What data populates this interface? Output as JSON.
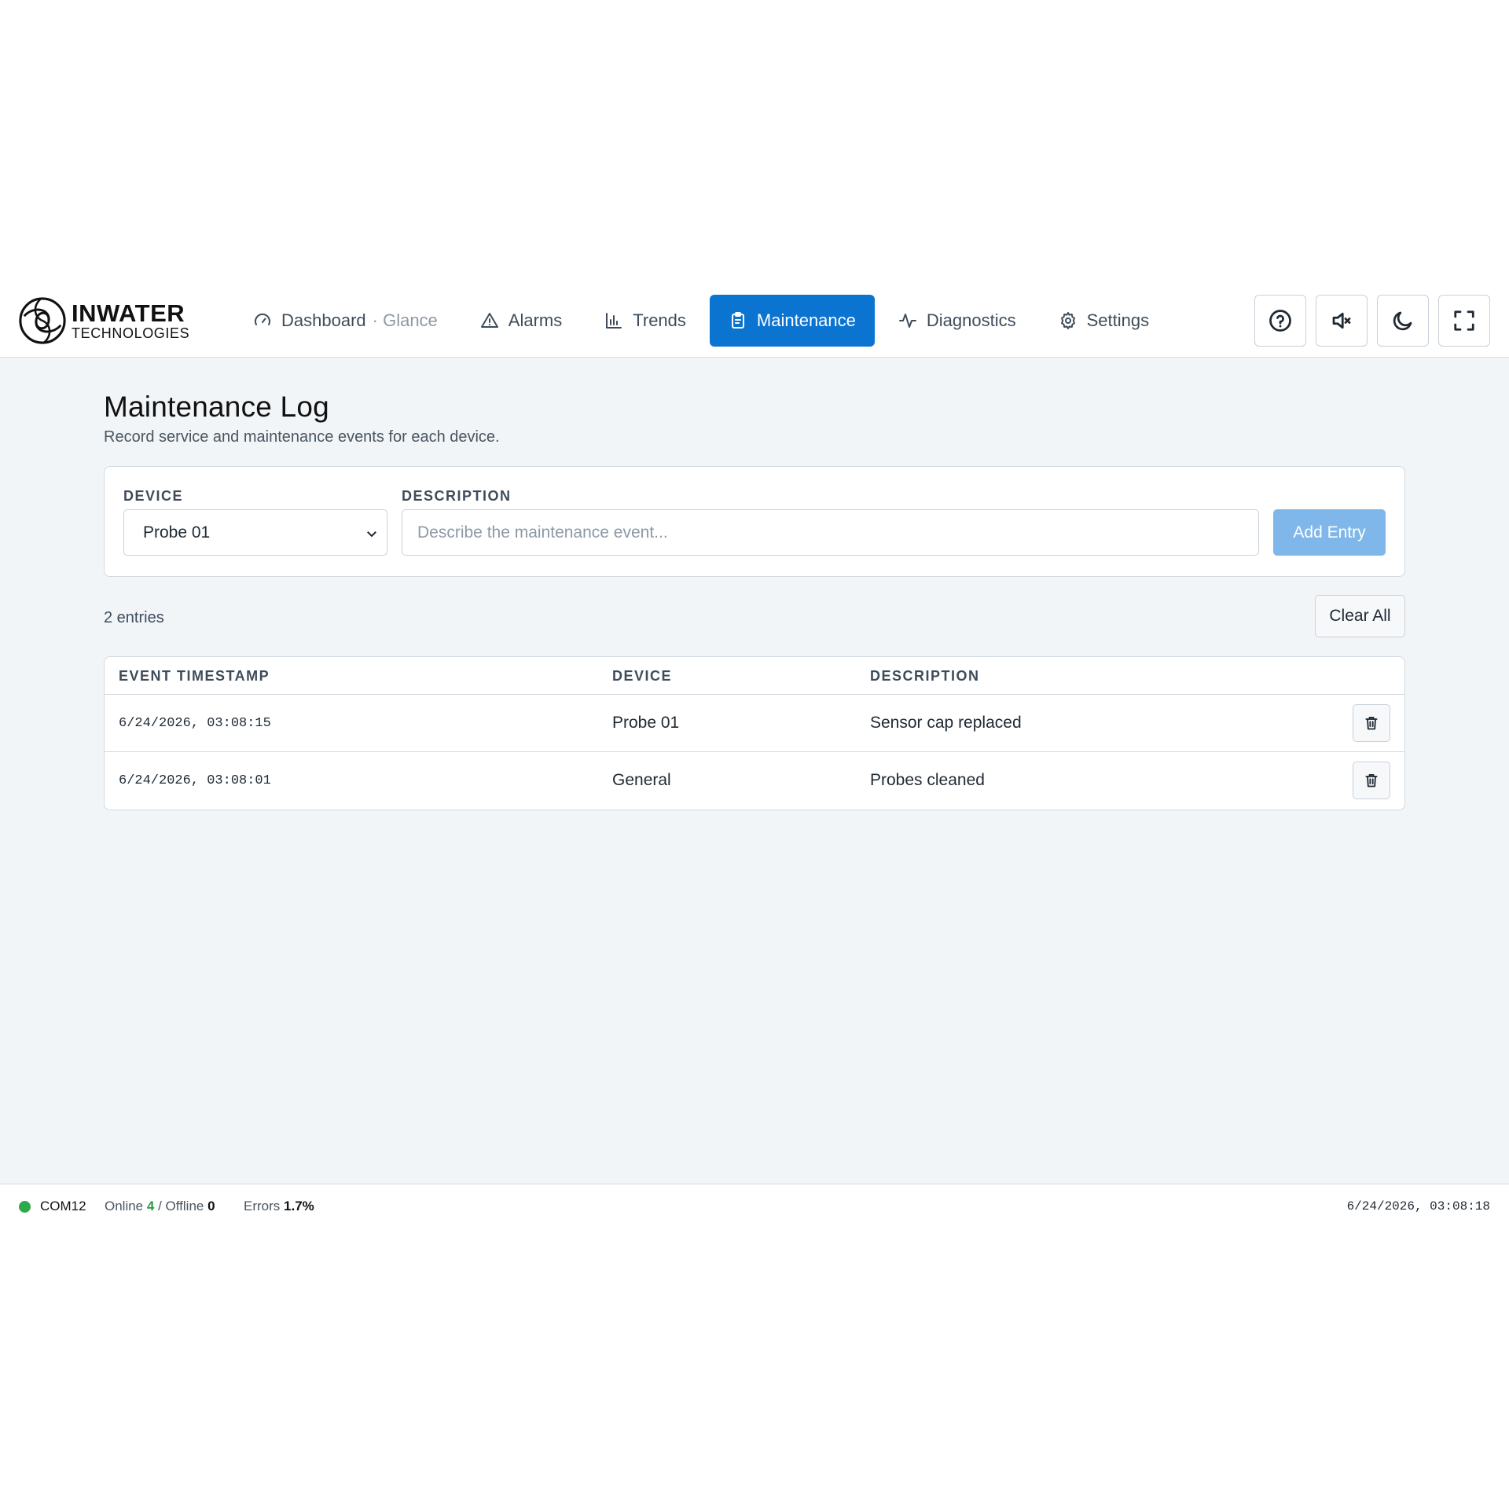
{
  "brand": {
    "name": "INWATER",
    "tagline": "TECHNOLOGIES"
  },
  "nav": {
    "items": [
      {
        "label": "Dashboard",
        "sub": "· Glance",
        "icon": "gauge-icon",
        "active": false
      },
      {
        "label": "Alarms",
        "icon": "warning-icon",
        "active": false
      },
      {
        "label": "Trends",
        "icon": "bar-chart-icon",
        "active": false
      },
      {
        "label": "Maintenance",
        "icon": "clipboard-icon",
        "active": true
      },
      {
        "label": "Diagnostics",
        "icon": "pulse-icon",
        "active": false
      },
      {
        "label": "Settings",
        "icon": "gear-icon",
        "active": false
      }
    ]
  },
  "toolbar": {
    "icons": [
      "help-icon",
      "mute-icon",
      "moon-icon",
      "fullscreen-icon"
    ]
  },
  "page": {
    "title": "Maintenance Log",
    "subtitle": "Record service and maintenance events for each device."
  },
  "form": {
    "device_label": "DEVICE",
    "device_value": "Probe 01",
    "description_label": "DESCRIPTION",
    "description_placeholder": "Describe the maintenance event...",
    "add_button": "Add Entry"
  },
  "log": {
    "count_text": "2 entries",
    "clear_button": "Clear All",
    "columns": [
      "EVENT TIMESTAMP",
      "DEVICE",
      "DESCRIPTION"
    ],
    "rows": [
      {
        "timestamp": "6/24/2026, 03:08:15",
        "device": "Probe 01",
        "description": "Sensor cap replaced"
      },
      {
        "timestamp": "6/24/2026, 03:08:01",
        "device": "General",
        "description": "Probes cleaned"
      }
    ]
  },
  "status": {
    "port": "COM12",
    "online_label": "Online",
    "online_count": "4",
    "offline_label": "/ Offline",
    "offline_count": "0",
    "errors_label": "Errors",
    "errors_value": "1.7%",
    "time": "6/24/2026, 03:08:18",
    "colors": {
      "online": "#2eaa4a",
      "accent": "#0b74d1"
    }
  }
}
